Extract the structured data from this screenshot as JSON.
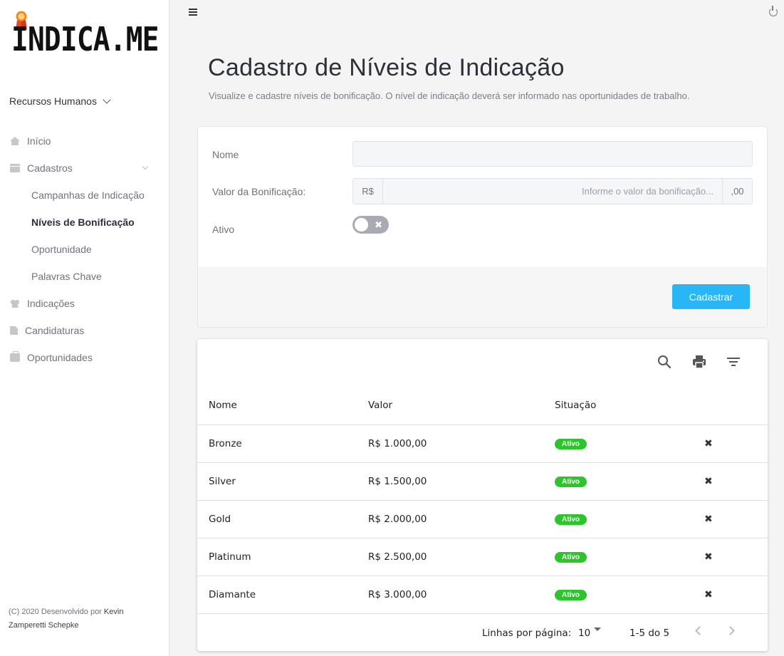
{
  "brand": {
    "logo_text": "INDICA.ME"
  },
  "sidebar": {
    "department": "Recursos Humanos",
    "items": [
      {
        "label": "Início",
        "icon": "home-icon"
      },
      {
        "label": "Cadastros",
        "icon": "archive-icon"
      },
      {
        "label": "Campanhas de Indicação"
      },
      {
        "label": "Níveis de Bonificação"
      },
      {
        "label": "Oportunidade"
      },
      {
        "label": "Palavras Chave"
      },
      {
        "label": "Indicações",
        "icon": "users-icon"
      },
      {
        "label": "Candidaturas",
        "icon": "file-icon"
      },
      {
        "label": "Oportunidades",
        "icon": "briefcase-icon"
      }
    ],
    "footer_prefix": "(C) 2020 Desenvolvido por",
    "footer_author": "Kevin Zamperetti Schepke"
  },
  "header": {
    "title": "Cadastro de Níveis de Indicação",
    "subtitle": "Visualize e cadastre níveis de bonificação. O nível de indicação deverá ser informado nas oportunidades de trabalho."
  },
  "form": {
    "name_label": "Nome",
    "name_value": "",
    "value_label": "Valor da Bonificação:",
    "currency_prefix": "R$",
    "value_placeholder": "Informe o valor da bonificação...",
    "decimal_suffix": ",00",
    "active_label": "Ativo",
    "active_on": false,
    "submit_label": "Cadastrar"
  },
  "table": {
    "columns": [
      "Nome",
      "Valor",
      "Situação"
    ],
    "rows": [
      {
        "name": "Bronze",
        "value": "R$ 1.000,00",
        "status": "Ativo"
      },
      {
        "name": "Silver",
        "value": "R$ 1.500,00",
        "status": "Ativo"
      },
      {
        "name": "Gold",
        "value": "R$ 2.000,00",
        "status": "Ativo"
      },
      {
        "name": "Platinum",
        "value": "R$ 2.500,00",
        "status": "Ativo"
      },
      {
        "name": "Diamante",
        "value": "R$ 3.000,00",
        "status": "Ativo"
      }
    ],
    "delete_glyph": "✖",
    "rows_per_page_label": "Linhas por página:",
    "rows_per_page": "10",
    "range": "1-5 do 5"
  },
  "colors": {
    "primary": "#29b6f6",
    "status_active": "#2cc52c"
  }
}
